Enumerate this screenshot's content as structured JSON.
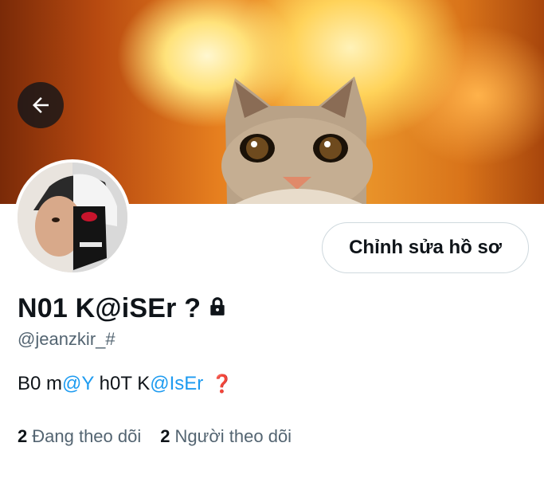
{
  "header": {
    "back_icon": "arrow-left-icon"
  },
  "profile": {
    "display_name": "N01 K@iSEr ?",
    "lock_icon": "lock-icon",
    "handle": "@jeanzkir_#",
    "edit_button_label": "Chỉnh sửa hồ sơ",
    "bio": {
      "part1": "B0 m",
      "mention1": "@Y",
      "part2": " h0T K",
      "mention2": "@IsEr",
      "emoji": "❓"
    },
    "stats": {
      "following_count": "2",
      "following_label": "Đang theo dõi",
      "followers_count": "2",
      "followers_label": "Người theo dõi"
    }
  },
  "colors": {
    "accent": "#1d9bf0",
    "muted_text": "#536471",
    "primary_text": "#0f1419"
  }
}
